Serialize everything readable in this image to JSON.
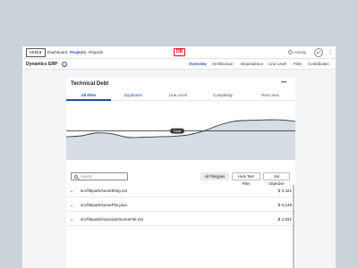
{
  "app": {
    "logo": "sema",
    "nav": [
      "Dashboard",
      "Projects",
      "Reports"
    ],
    "active_nav": "Projects",
    "brand_mark": "DB",
    "activity_label": "Activity",
    "avatar_initials": "AT",
    "more_glyph": "⋮"
  },
  "project": {
    "name": "Dynamics ERP",
    "chevron_glyph": "⌄",
    "tabs": [
      "Overview",
      "Architecture",
      "Dependence",
      "Line Level",
      "Files",
      "Contribution"
    ],
    "active_tab": "Overview"
  },
  "card": {
    "title": "Technical Debt",
    "more_glyph": "•••",
    "tabs": [
      "All Files",
      "Duplicates",
      "Line Level",
      "Complexity",
      "Test Lines"
    ],
    "active_tab": "All Files"
  },
  "chart_data": {
    "type": "area",
    "title": "",
    "xlabel": "",
    "ylabel": "",
    "series": [
      {
        "values": [
          48,
          50,
          56,
          54,
          47,
          47,
          48,
          49,
          52,
          60,
          72,
          80,
          82,
          83,
          83,
          80
        ]
      }
    ],
    "goal": {
      "label": "Goal",
      "value": 60
    },
    "ylim": [
      0,
      100
    ],
    "grid": false,
    "colors": {
      "line": "#23374d",
      "fill": "#d6dde3",
      "goal_line": "#222222",
      "goal_badge": "#3a3a3a"
    }
  },
  "toolbar": {
    "search_placeholder": "Search",
    "filetypes_label": "All Filetypes",
    "hide_test_label": "Hide Test Files",
    "objective_label": "Set Objective"
  },
  "rows": [
    {
      "chevron": "⌄",
      "path": "src/filepath/something.ext",
      "value": "$ 3,421"
    },
    {
      "chevron": "⌄",
      "path": "src/filepath/someFile.java",
      "value": "$ 0,148"
    },
    {
      "chevron": "⌄",
      "path": "src/filepath/important/someFile.ext",
      "value": "$ 2,831"
    }
  ]
}
